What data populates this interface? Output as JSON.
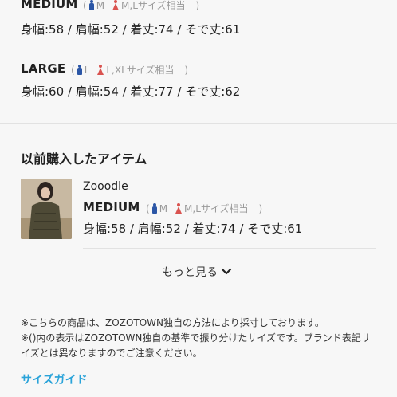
{
  "sizes": [
    {
      "name": "MEDIUM",
      "paren_open": "(",
      "male_label": "M",
      "female_label": "M,Lサイズ相当",
      "paren_close": ")",
      "measurements": "身幅:58 / 肩幅:52 / 着丈:74 / そで丈:61"
    },
    {
      "name": "LARGE",
      "paren_open": "(",
      "male_label": "L",
      "female_label": "L,XLサイズ相当",
      "paren_close": ")",
      "measurements": "身幅:60 / 肩幅:54 / 着丈:77 / そで丈:62"
    }
  ],
  "purchased": {
    "title": "以前購入したアイテム",
    "item": {
      "brand": "Zooodle",
      "size": "MEDIUM",
      "paren_open": "(",
      "male_label": "M",
      "female_label": "M,Lサイズ相当",
      "paren_close": ")",
      "measurements": "身幅:58 / 肩幅:52 / 着丈:74 / そで丈:61"
    }
  },
  "more_label": "もっと見る",
  "notes": [
    "※こちらの商品は、ZOZOTOWN独自の方法により採寸しております。",
    "※()内の表示はZOZOTOWN独自の基準で振り分けたサイズです。ブランド表記サイズとは異なりますのでご注意ください。"
  ],
  "size_guide_label": "サイズガイド",
  "colors": {
    "male": "#2b56a6",
    "female": "#d9534f",
    "link": "#2aa3d9"
  }
}
